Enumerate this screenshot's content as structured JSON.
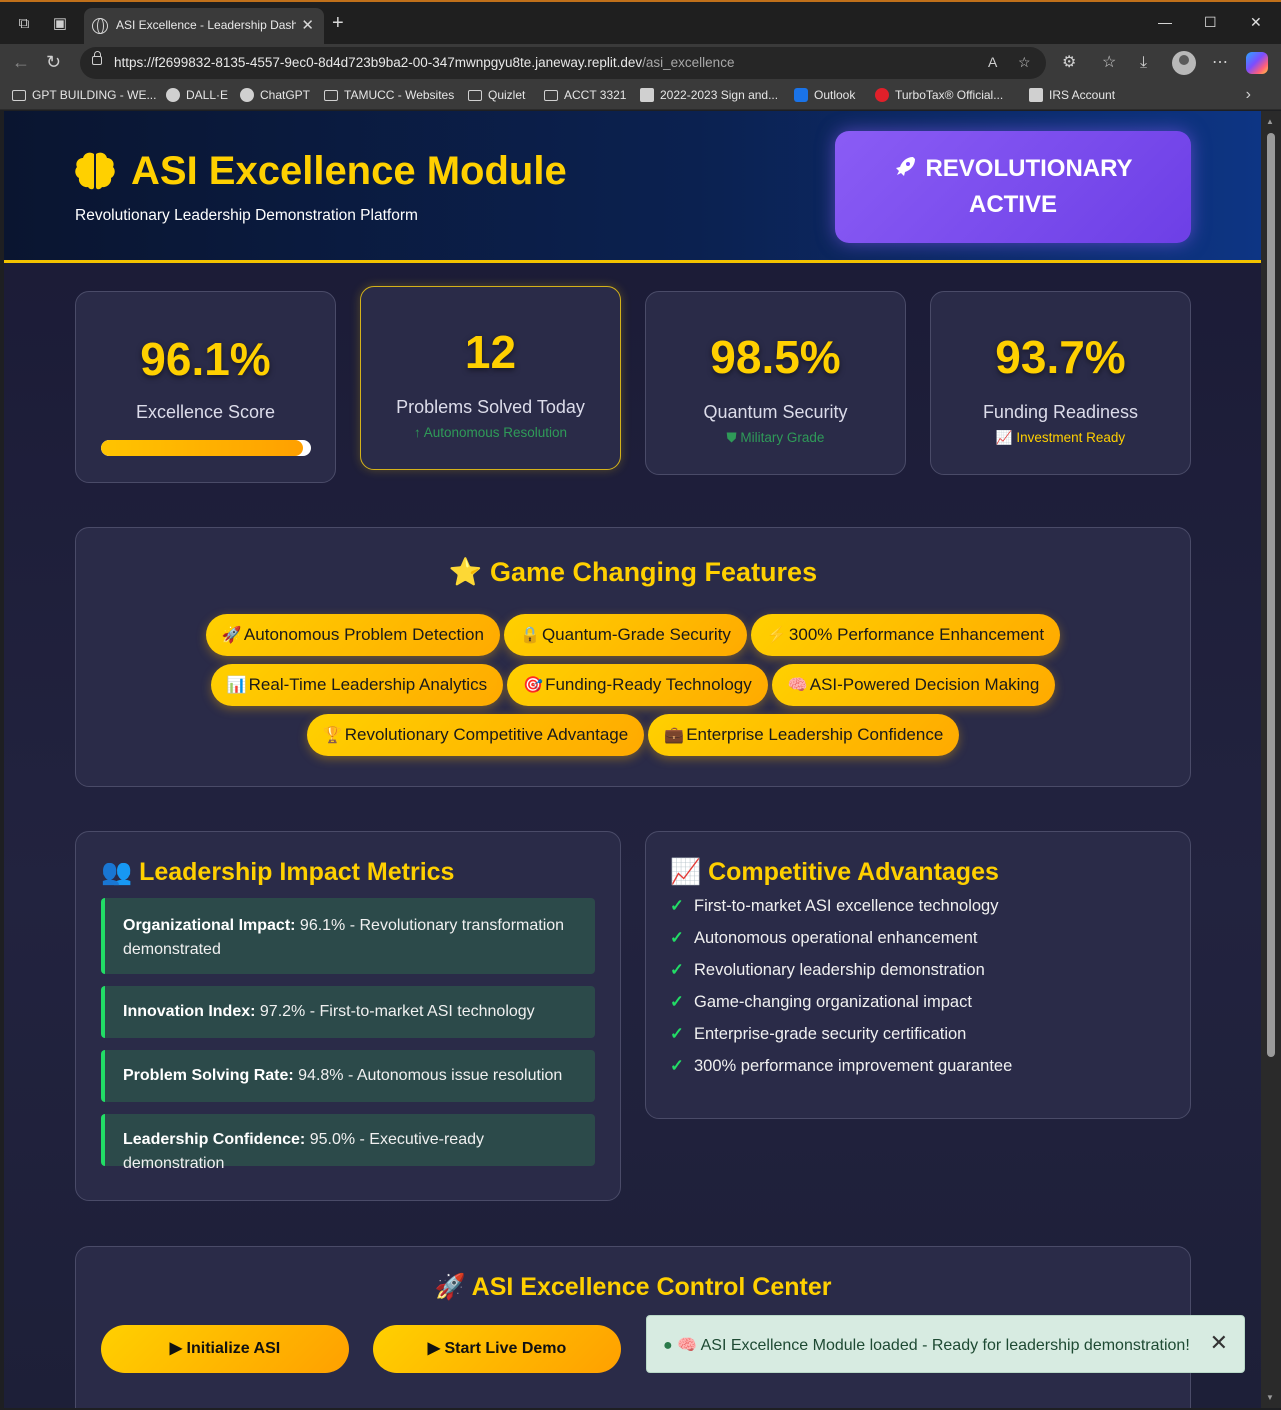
{
  "browser": {
    "tab_title": "ASI Excellence - Leadership Dashb",
    "url_main": "https://f2699832-8135-4557-9ec0-8d4d723b9ba2-00-347mwnpgyu8te.janeway.replit.dev",
    "url_path": "/asi_excellence",
    "bookmarks": [
      "GPT BUILDING - WE...",
      "DALL·E",
      "ChatGPT",
      "TAMUCC - Websites",
      "Quizlet",
      "ACCT 3321",
      "2022-2023 Sign and...",
      "Outlook",
      "TurboTax® Official...",
      "IRS Account"
    ]
  },
  "header": {
    "title": "ASI Excellence Module",
    "subtitle": "Revolutionary Leadership Demonstration Platform",
    "status_line1": "REVOLUTIONARY",
    "status_line2": "ACTIVE"
  },
  "stats": [
    {
      "value": "96.1%",
      "label": "Excellence Score",
      "progress": 0.961
    },
    {
      "value": "12",
      "label": "Problems Solved Today",
      "sub": "Autonomous Resolution"
    },
    {
      "value": "98.5%",
      "label": "Quantum Security",
      "sub": "Military Grade"
    },
    {
      "value": "93.7%",
      "label": "Funding Readiness",
      "sub": "Investment Ready"
    }
  ],
  "features": {
    "title": "Game Changing Features",
    "items": [
      {
        "emoji": "🚀",
        "label": "Autonomous Problem Detection"
      },
      {
        "emoji": "🔒",
        "label": "Quantum-Grade Security"
      },
      {
        "emoji": "⚡",
        "label": "300% Performance Enhancement"
      },
      {
        "emoji": "📊",
        "label": "Real-Time Leadership Analytics"
      },
      {
        "emoji": "🎯",
        "label": "Funding-Ready Technology"
      },
      {
        "emoji": "🧠",
        "label": "ASI-Powered Decision Making"
      },
      {
        "emoji": "🏆",
        "label": "Revolutionary Competitive Advantage"
      },
      {
        "emoji": "💼",
        "label": "Enterprise Leadership Confidence"
      }
    ]
  },
  "metrics": {
    "title": "Leadership Impact Metrics",
    "items": [
      {
        "name": "Organizational Impact:",
        "text": " 96.1% - Revolutionary transformation demonstrated"
      },
      {
        "name": "Innovation Index:",
        "text": " 97.2% - First-to-market ASI technology"
      },
      {
        "name": "Problem Solving Rate:",
        "text": " 94.8% - Autonomous issue resolution"
      },
      {
        "name": "Leadership Confidence:",
        "text": " 95.0% - Executive-ready demonstration"
      }
    ]
  },
  "advantages": {
    "title": "Competitive Advantages",
    "items": [
      "First-to-market ASI excellence technology",
      "Autonomous operational enhancement",
      "Revolutionary leadership demonstration",
      "Game-changing organizational impact",
      "Enterprise-grade security certification",
      "300% performance improvement guarantee"
    ]
  },
  "control": {
    "title": "ASI Excellence Control Center",
    "init_label": "Initialize ASI",
    "demo_label": "Start Live Demo"
  },
  "toast": {
    "message": "🧠 ASI Excellence Module loaded - Ready for leadership demonstration!"
  },
  "colors": {
    "accent": "#ffd000",
    "success": "#22dd66",
    "purple": "#7c4dff"
  }
}
